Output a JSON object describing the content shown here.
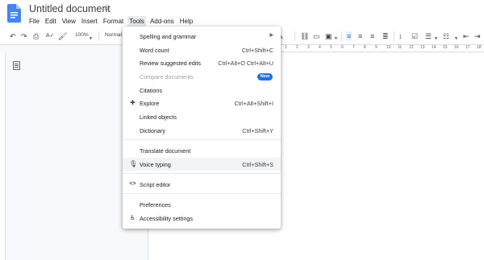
{
  "colors": {
    "accent": "#1a73e8",
    "doc_blue": "#4285f4",
    "badge": "#1a73e8"
  },
  "header": {
    "title": "Untitled document",
    "star_icon": "star-icon",
    "menus": [
      "File",
      "Edit",
      "View",
      "Insert",
      "Format",
      "Tools",
      "Add-ons",
      "Help"
    ],
    "active_menu": "Tools"
  },
  "toolbar": {
    "zoom": "100%",
    "style": "Normal",
    "icons": [
      "undo-icon",
      "redo-icon",
      "print-icon",
      "spellcheck-icon",
      "paint-format-icon",
      "link-icon",
      "comment-icon",
      "image-icon",
      "align-left-icon",
      "align-center-icon",
      "align-right-icon",
      "justify-icon",
      "line-spacing-icon",
      "checklist-icon",
      "bullet-list-icon",
      "numbered-list-icon",
      "pen-icon"
    ]
  },
  "ruler": {
    "numbers": [
      "1",
      "2",
      "3",
      "4",
      "5",
      "6",
      "7",
      "8",
      "9",
      "10",
      "11",
      "12",
      "13",
      "14",
      "15",
      "16",
      "17",
      "18"
    ]
  },
  "tools_menu": {
    "spelling": {
      "label": "Spelling and grammar"
    },
    "word_count": {
      "label": "Word count",
      "shortcut": "Ctrl+Shift+C"
    },
    "review_edits": {
      "label": "Review suggested edits",
      "shortcut": "Ctrl+Alt+O Ctrl+Alt+U"
    },
    "compare": {
      "label": "Compare documents",
      "badge": "New"
    },
    "citations": {
      "label": "Citations"
    },
    "explore": {
      "label": "Explore",
      "shortcut": "Ctrl+Alt+Shift+I"
    },
    "linked_objects": {
      "label": "Linked objects"
    },
    "dictionary": {
      "label": "Dictionary",
      "shortcut": "Ctrl+Shift+Y"
    },
    "translate": {
      "label": "Translate document"
    },
    "voice_typing": {
      "label": "Voice typing",
      "shortcut": "Ctrl+Shift+S"
    },
    "script_editor": {
      "label": "Script editor"
    },
    "preferences": {
      "label": "Preferences"
    },
    "accessibility": {
      "label": "Accessibility settings"
    }
  }
}
